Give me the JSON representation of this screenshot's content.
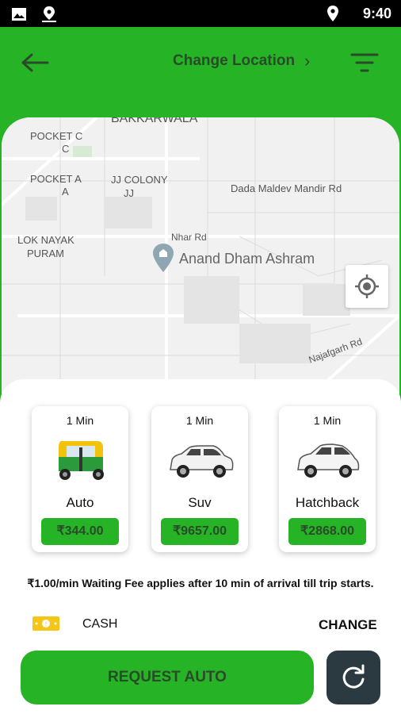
{
  "status_bar": {
    "time": "9:40"
  },
  "header": {
    "title": "Change Location"
  },
  "map": {
    "labels": [
      "BAKKARWALA",
      "POCKET C",
      "C",
      "POCKET A",
      "A",
      "JJ COLONY",
      "JJ",
      "Dada Maldev Mandir Rd",
      "LOK NAYAK",
      "PURAM",
      "Nhar Rd",
      "Anand Dham Ashram",
      "Najafgarh Rd"
    ]
  },
  "vehicles": [
    {
      "eta": "1 Min",
      "name": "Auto",
      "price": "₹344.00"
    },
    {
      "eta": "1 Min",
      "name": "Suv",
      "price": "₹9657.00"
    },
    {
      "eta": "1 Min",
      "name": "Hatchback",
      "price": "₹2868.00"
    }
  ],
  "waiting_note": "₹1.00/min Waiting Fee applies after 10 min of arrival till trip starts.",
  "payment": {
    "method": "CASH",
    "change_label": "CHANGE"
  },
  "request_button": "REQUEST AUTO",
  "colors": {
    "brand_green": "#26b326",
    "dark_text": "#2a4b2a",
    "refresh_bg": "#2b3a40"
  }
}
